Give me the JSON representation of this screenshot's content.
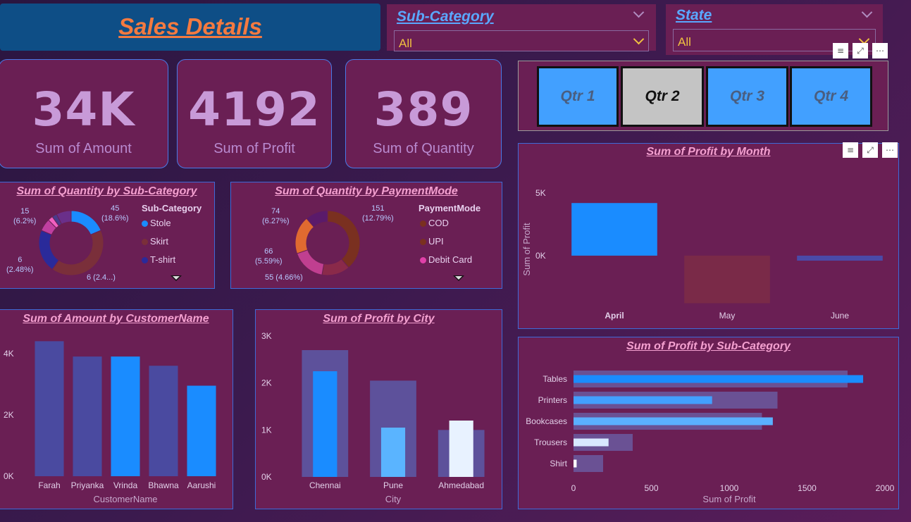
{
  "header": {
    "title": "Sales Details"
  },
  "slicers": {
    "subcategory": {
      "title": "Sub-Category",
      "value": "All"
    },
    "state": {
      "title": "State",
      "value": "All"
    }
  },
  "kpis": [
    {
      "value": "34K",
      "label": "Sum of Amount"
    },
    {
      "value": "4192",
      "label": "Sum of Profit"
    },
    {
      "value": "389",
      "label": "Sum of Quantity"
    }
  ],
  "quarters": {
    "buttons": [
      "Qtr 1",
      "Qtr 2",
      "Qtr 3",
      "Qtr 4"
    ],
    "selected": "Qtr 2",
    "colors": {
      "normal": "#42a0ff",
      "selected": "#c4c4c4"
    }
  },
  "colors": {
    "accent_blue": "#1a8cff",
    "panel_bg": "#6a1f54",
    "title_pink": "#f4a0d0"
  },
  "chart_data": [
    {
      "id": "qty_subcat",
      "type": "pie",
      "title": "Sum of Quantity by Sub-Category",
      "legend_title": "Sub-Category",
      "legend": [
        "Stole",
        "Skirt",
        "T-shirt"
      ],
      "legend_colors": [
        "#1a8cff",
        "#7a2f3a",
        "#2a2a9a"
      ],
      "labels": [
        {
          "value": "45",
          "pct": "(18.6%)"
        },
        {
          "value": "15",
          "pct": "(6.2%)"
        },
        {
          "value": "6",
          "pct": "(2.48%)"
        },
        {
          "value": "6 (2.4...)",
          "pct": ""
        }
      ],
      "slices": [
        {
          "value": 45,
          "color": "#1a8cff"
        },
        {
          "value": 100,
          "color": "#7a2f3a"
        },
        {
          "value": 52,
          "color": "#2a2a9a"
        },
        {
          "value": 15,
          "color": "#c03fa0"
        },
        {
          "value": 6,
          "color": "#f060c0"
        },
        {
          "value": 6,
          "color": "#4a3a8a"
        },
        {
          "value": 18,
          "color": "#6a2f8a"
        }
      ]
    },
    {
      "id": "qty_payment",
      "type": "pie",
      "title": "Sum of Quantity by PaymentMode",
      "legend_title": "PaymentMode",
      "legend": [
        "COD",
        "UPI",
        "Debit Card"
      ],
      "legend_colors": [
        "#7a3020",
        "#7a3020",
        "#e040a8"
      ],
      "labels": [
        {
          "value": "151",
          "pct": "(12.79%)"
        },
        {
          "value": "74",
          "pct": "(6.27%)"
        },
        {
          "value": "66",
          "pct": "(5.59%)"
        },
        {
          "value": "55 (4.66%)",
          "pct": ""
        }
      ],
      "slices": [
        {
          "value": 151,
          "color": "#7a3020"
        },
        {
          "value": 55,
          "color": "#8a2a4a"
        },
        {
          "value": 66,
          "color": "#c03f90"
        },
        {
          "value": 74,
          "color": "#e06a30"
        },
        {
          "value": 44,
          "color": "#5a1a6a"
        }
      ]
    },
    {
      "id": "profit_month",
      "type": "bar",
      "title": "Sum of Profit by Month",
      "categories": [
        "April",
        "May",
        "June"
      ],
      "values": [
        4200,
        -3800,
        -400
      ],
      "colors": [
        "#1a8cff",
        "#7a2a48",
        "#4a4aa8"
      ],
      "ylabel": "Sum of Profit",
      "ylim": [
        -4000,
        5000
      ],
      "yticks": [
        "5K",
        "0K"
      ],
      "yticks_values": [
        5000,
        0
      ]
    },
    {
      "id": "amount_customer",
      "type": "bar",
      "title": "Sum of Amount by CustomerName",
      "categories": [
        "Farah",
        "Priyanka",
        "Vrinda",
        "Bhawna",
        "Aarushi"
      ],
      "values": [
        4400,
        3900,
        3900,
        3600,
        2950
      ],
      "colors": [
        "#4a4aa0",
        "#4a4aa0",
        "#1a8cff",
        "#4a4aa0",
        "#1a8cff"
      ],
      "xlabel": "CustomerName",
      "ylim": [
        0,
        4500
      ],
      "yticks": [
        "0K",
        "2K",
        "4K"
      ],
      "yticks_values": [
        0,
        2000,
        4000
      ]
    },
    {
      "id": "profit_city",
      "type": "bar",
      "title": "Sum of Profit by City",
      "categories": [
        "Chennai",
        "Pune",
        "Ahmedabad"
      ],
      "series": [
        {
          "values": [
            2700,
            2050,
            1000
          ],
          "color": "#5a5aa8"
        },
        {
          "values": [
            2250,
            1050,
            1200
          ],
          "colors": [
            "#1a8cff",
            "#5ab4ff",
            "#e8f2ff"
          ]
        }
      ],
      "xlabel": "City",
      "ylim": [
        0,
        3000
      ],
      "yticks": [
        "0K",
        "1K",
        "2K",
        "3K"
      ],
      "yticks_values": [
        0,
        1000,
        2000,
        3000
      ]
    },
    {
      "id": "profit_subcat",
      "type": "bar",
      "orientation": "horizontal",
      "title": "Sum of Profit by Sub-Category",
      "categories": [
        "Tables",
        "Printers",
        "Bookcases",
        "Trousers",
        "Shirt"
      ],
      "series": [
        {
          "values": [
            1760,
            1310,
            1210,
            380,
            190
          ],
          "color": "#6a5aa0"
        },
        {
          "values": [
            1860,
            890,
            1280,
            225,
            20
          ],
          "colors": [
            "#1a8cff",
            "#42a0ff",
            "#5ab0ff",
            "#d8e8ff",
            "#ffffff"
          ]
        }
      ],
      "xlabel": "Sum of Profit",
      "xlim": [
        0,
        2000
      ],
      "xticks": [
        "0",
        "500",
        "1000",
        "1500",
        "2000"
      ],
      "xticks_values": [
        0,
        500,
        1000,
        1500,
        2000
      ]
    }
  ]
}
